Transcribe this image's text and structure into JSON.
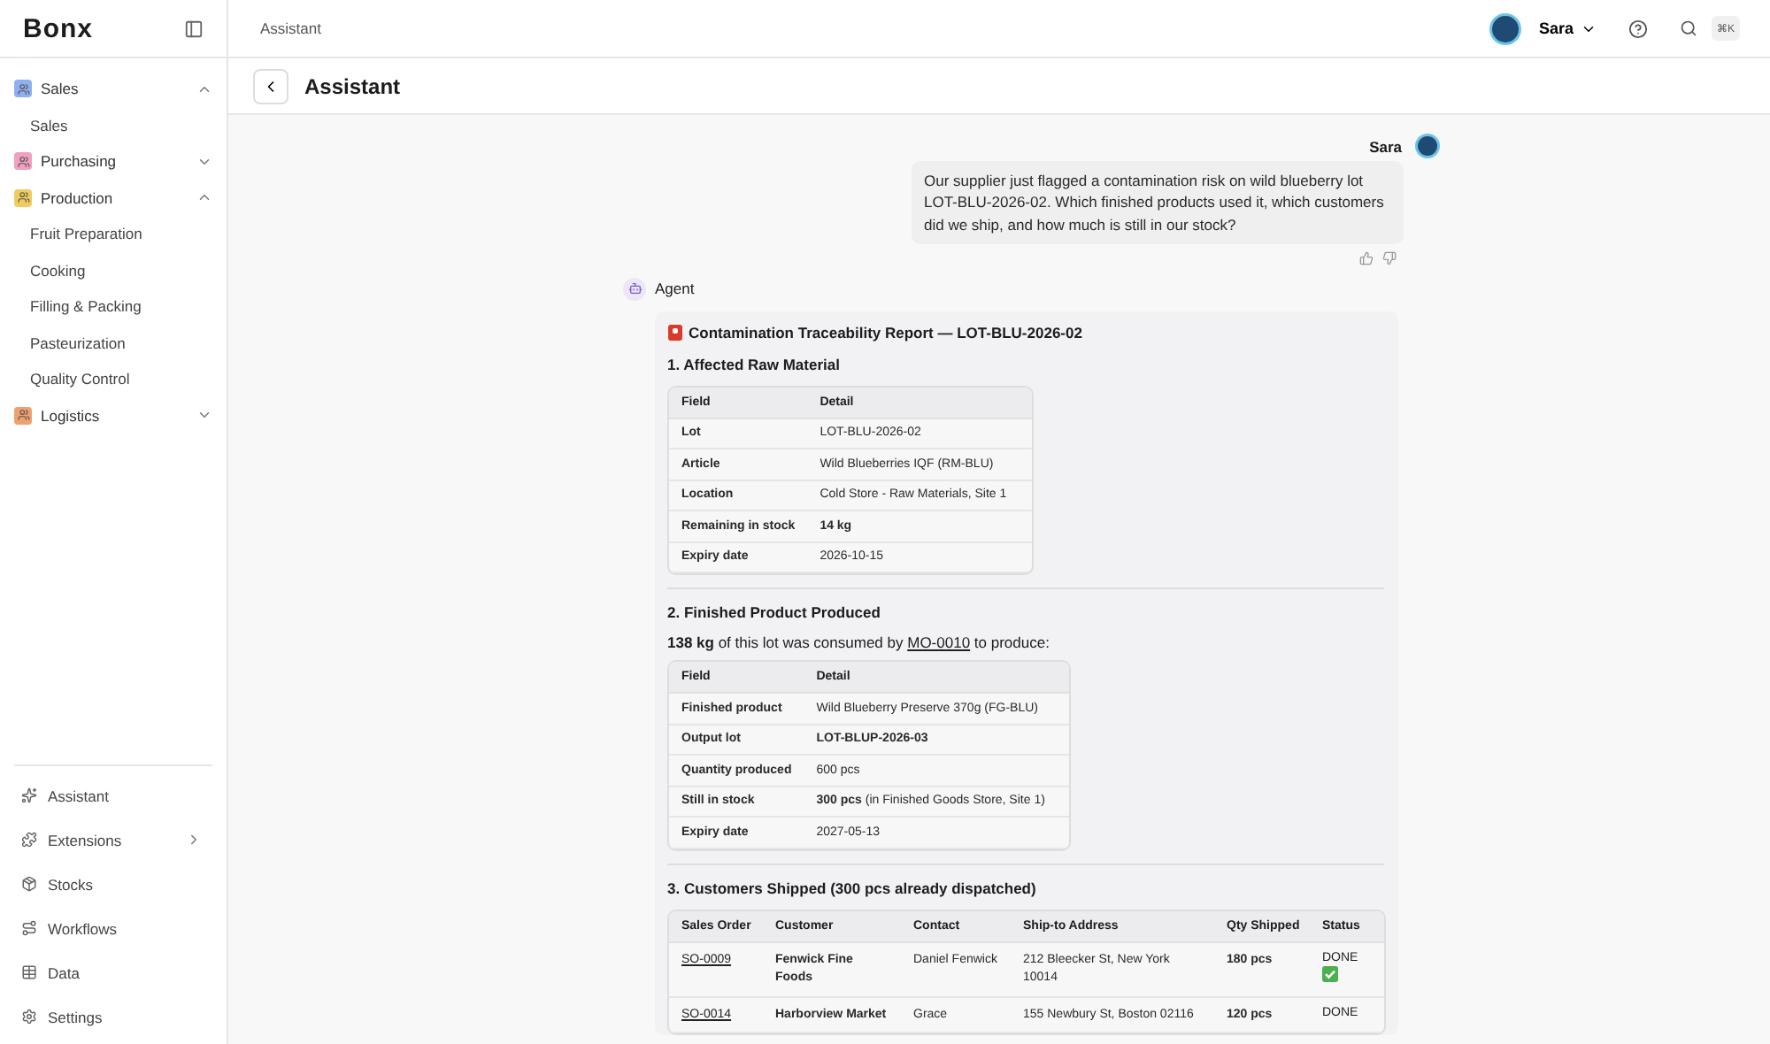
{
  "logo": "Bonx",
  "sidebar": {
    "sections": [
      {
        "label": "Sales",
        "color": "#8fb0f0",
        "expanded": true,
        "children": [
          {
            "label": "Sales"
          }
        ]
      },
      {
        "label": "Purchasing",
        "color": "#f0a0c0",
        "expanded": false
      },
      {
        "label": "Production",
        "color": "#f0cc60",
        "expanded": true,
        "children": [
          {
            "label": "Fruit Preparation"
          },
          {
            "label": "Cooking"
          },
          {
            "label": "Filling & Packing"
          },
          {
            "label": "Pasteurization"
          },
          {
            "label": "Quality Control"
          }
        ]
      },
      {
        "label": "Logistics",
        "color": "#f0a070",
        "expanded": false
      }
    ],
    "bottom": [
      {
        "label": "Assistant",
        "kind": "sparkle",
        "submenu": false
      },
      {
        "label": "Extensions",
        "kind": "puzzle",
        "submenu": true
      },
      {
        "label": "Stocks",
        "kind": "box",
        "submenu": false
      },
      {
        "label": "Workflows",
        "kind": "route",
        "submenu": false
      },
      {
        "label": "Data",
        "kind": "table",
        "submenu": false
      },
      {
        "label": "Settings",
        "kind": "gear",
        "submenu": false
      }
    ]
  },
  "topbar": {
    "breadcrumb": "Assistant",
    "user": "Sara",
    "shortcut": "⌘K"
  },
  "page_title": "Assistant",
  "user_message": {
    "name": "Sara",
    "text": "Our supplier just flagged a contamination risk on wild blueberry lot LOT-BLU-2026-02. Which finished products used it, which customers did we ship, and how much is still in our stock?"
  },
  "agent": {
    "name": "Agent",
    "title": "Contamination Traceability Report — LOT-BLU-2026-02",
    "sections": [
      {
        "heading": "1. Affected Raw Material",
        "kind": "fields",
        "columns": [
          "Field",
          "Detail"
        ],
        "rows": [
          {
            "field": "Lot",
            "detail": "LOT-BLU-2026-02",
            "bold": false
          },
          {
            "field": "Article",
            "detail": "Wild Blueberries IQF (RM-BLU)",
            "bold": false
          },
          {
            "field": "Location",
            "detail": "Cold Store - Raw Materials, Site 1",
            "bold": false
          },
          {
            "field": "Remaining in stock",
            "detail": "14 kg",
            "bold": true
          },
          {
            "field": "Expiry date",
            "detail": "2026-10-15",
            "bold": false
          }
        ]
      },
      {
        "heading": "2. Finished Product Produced",
        "kind": "fields",
        "intro": {
          "before": "**138 kg** of this lot was consumed by ",
          "link": "MO-0010",
          "after": " to produce:"
        },
        "columns": [
          "Field",
          "Detail"
        ],
        "rows": [
          {
            "field": "Finished product",
            "detail": "Wild Blueberry Preserve 370g (FG-BLU)",
            "bold": false
          },
          {
            "field": "Output lot",
            "detail": "LOT-BLUP-2026-03",
            "bold": true
          },
          {
            "field": "Quantity produced",
            "detail": "600 pcs",
            "bold": false
          },
          {
            "field": "Still in stock",
            "detail": "**300 pcs** (in Finished Goods Store, Site 1)",
            "bold": false
          },
          {
            "field": "Expiry date",
            "detail": "2027-05-13",
            "bold": false
          }
        ]
      },
      {
        "heading": "3. Customers Shipped (300 pcs already dispatched)",
        "kind": "orders",
        "columns": [
          "Sales Order",
          "Customer",
          "Contact",
          "Ship-to Address",
          "Qty Shipped",
          "Status"
        ],
        "rows": [
          {
            "order": "SO-0009",
            "customer": "Fenwick Fine Foods",
            "contact": "Daniel Fenwick",
            "address": "212 Bleecker St, New York 10014",
            "qty": "180 pcs",
            "status": "DONE",
            "done": true
          },
          {
            "order": "SO-0014",
            "customer": "Harborview Market",
            "contact": "Grace",
            "address": "155 Newbury St, Boston 02116",
            "qty": "120 pcs",
            "status": "DONE"
          }
        ]
      }
    ]
  }
}
